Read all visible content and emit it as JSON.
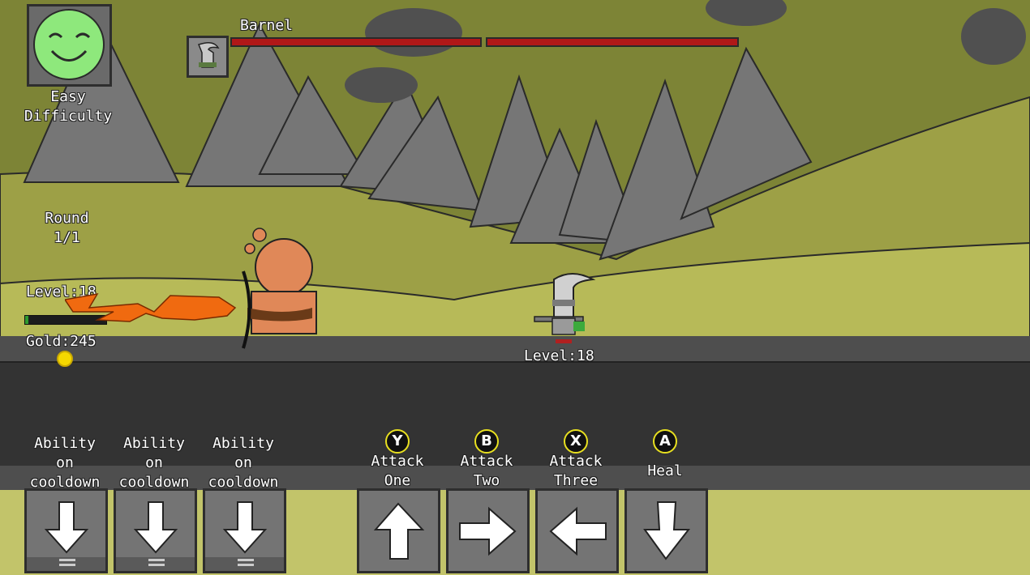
{
  "difficulty": {
    "line1": "Easy",
    "line2": "Difficulty",
    "face_color": "#8ee87c"
  },
  "enemy": {
    "name": "Barnel",
    "level_text": "Level:18",
    "health_color": "#b01818"
  },
  "round": {
    "label": "Round",
    "value": "1/1"
  },
  "player": {
    "level_text": "Level:18",
    "gold_text": "Gold:245",
    "xp_progress": 0.0
  },
  "abilities": [
    {
      "line1": "Ability",
      "line2": "on",
      "line3": "cooldown",
      "icon": "arrow-down-icon"
    },
    {
      "line1": "Ability",
      "line2": "on",
      "line3": "cooldown",
      "icon": "arrow-down-icon"
    },
    {
      "line1": "Ability",
      "line2": "on",
      "line3": "cooldown",
      "icon": "arrow-down-icon"
    }
  ],
  "attacks": [
    {
      "glyph": "Y",
      "line1": "Attack",
      "line2": "One",
      "icon": "arrow-up-icon"
    },
    {
      "glyph": "B",
      "line1": "Attack",
      "line2": "Two",
      "icon": "arrow-right-icon"
    },
    {
      "glyph": "X",
      "line1": "Attack",
      "line2": "Three",
      "icon": "arrow-left-icon"
    },
    {
      "glyph": "A",
      "line1": "Heal",
      "line2": "",
      "icon": "arrow-down-icon"
    }
  ],
  "colors": {
    "sky": "#7d8436",
    "grass": "#b7ba58",
    "road": "#333333",
    "mountains": "#767676",
    "gold": "#f5d800"
  }
}
